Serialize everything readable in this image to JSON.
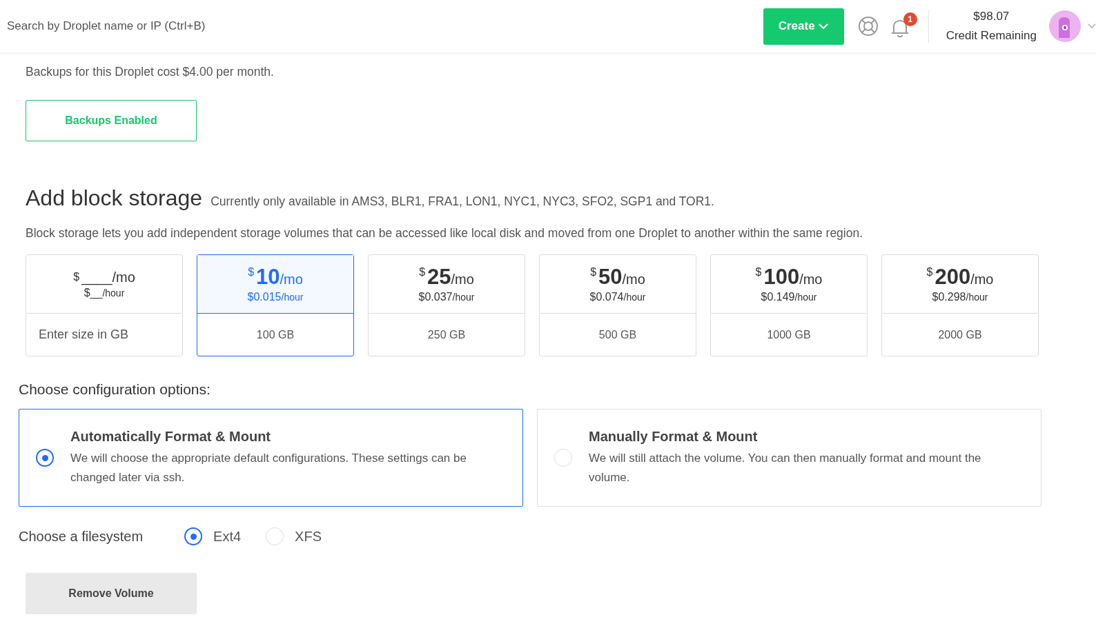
{
  "header": {
    "search": {
      "placeholder": "Search by Droplet name or IP (Ctrl+B)"
    },
    "create_button": "Create",
    "notifications": {
      "count": "1"
    },
    "credit": {
      "amount": "$98.07",
      "label": "Credit Remaining"
    }
  },
  "backups": {
    "cost_text": "Backups for this Droplet cost $4.00 per month.",
    "button": "Backups Enabled"
  },
  "block_storage": {
    "title": "Add block storage",
    "availability": "Currently only available in AMS3, BLR1, FRA1, LON1, NYC1, NYC3, SFO2, SGP1 and TOR1.",
    "description": "Block storage lets you add independent storage volumes that can be accessed like local disk and moved from one Droplet to another within the same region.",
    "plans": [
      {
        "kind": "custom",
        "currency": "$",
        "price": "____",
        "per_month": "/mo",
        "hourly": "$__",
        "per_hour": "/hour",
        "placeholder": "Enter size in GB",
        "selected": false
      },
      {
        "kind": "fixed",
        "currency": "$",
        "price": "10",
        "per_month": "/mo",
        "hourly": "$0.015",
        "per_hour": "/hour",
        "size": "100 GB",
        "selected": true
      },
      {
        "kind": "fixed",
        "currency": "$",
        "price": "25",
        "per_month": "/mo",
        "hourly": "$0.037",
        "per_hour": "/hour",
        "size": "250 GB",
        "selected": false
      },
      {
        "kind": "fixed",
        "currency": "$",
        "price": "50",
        "per_month": "/mo",
        "hourly": "$0.074",
        "per_hour": "/hour",
        "size": "500 GB",
        "selected": false
      },
      {
        "kind": "fixed",
        "currency": "$",
        "price": "100",
        "per_month": "/mo",
        "hourly": "$0.149",
        "per_hour": "/hour",
        "size": "1000 GB",
        "selected": false
      },
      {
        "kind": "fixed",
        "currency": "$",
        "price": "200",
        "per_month": "/mo",
        "hourly": "$0.298",
        "per_hour": "/hour",
        "size": "2000 GB",
        "selected": false
      }
    ]
  },
  "configuration": {
    "title": "Choose configuration options:",
    "options": [
      {
        "title": "Automatically Format & Mount",
        "description": "We will choose the appropriate default configurations. These settings can be changed later via ssh.",
        "selected": true
      },
      {
        "title": "Manually Format & Mount",
        "description": "We will still attach the volume. You can then manually format and mount the volume.",
        "selected": false
      }
    ]
  },
  "filesystem": {
    "label": "Choose a filesystem",
    "options": [
      {
        "label": "Ext4",
        "selected": true
      },
      {
        "label": "XFS",
        "selected": false
      }
    ]
  },
  "remove_button": "Remove Volume"
}
